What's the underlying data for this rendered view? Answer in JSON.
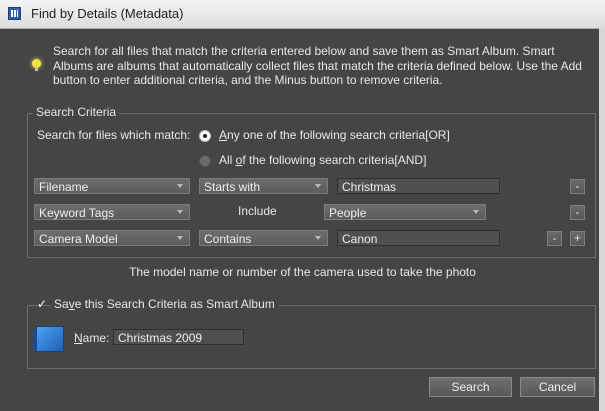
{
  "window": {
    "title": "Find by Details (Metadata)"
  },
  "info": {
    "text": "Search for all files that match the criteria entered below and save them as Smart Album. Smart Albums are albums that automatically collect files that match the criteria defined below. Use the Add button to enter additional criteria, and the Minus button to remove criteria."
  },
  "search_criteria": {
    "legend": "Search Criteria",
    "match_label": "Search for files which match:",
    "options": [
      {
        "pre": "",
        "u": "A",
        "post": "ny one of the following search criteria[OR]",
        "selected": true
      },
      {
        "pre": "All ",
        "u": "o",
        "post": "f the following search criteria[AND]",
        "selected": false
      }
    ],
    "rows": [
      {
        "field": "Filename",
        "operator": "Starts with",
        "value": "Christmas"
      },
      {
        "field": "Keyword Tags",
        "operator": "Include",
        "value": "People"
      },
      {
        "field": "Camera Model",
        "operator": "Contains",
        "value": "Canon"
      }
    ],
    "minus_label": "-",
    "plus_label": "+"
  },
  "hint": "The model name or number of the camera used to take the photo",
  "save": {
    "checked": true,
    "check_glyph": "✓",
    "legend_pre": "Sa",
    "legend_u": "v",
    "legend_post": "e this Search Criteria as Smart Album",
    "name_label_u": "N",
    "name_label_post": "ame:",
    "name_value": "Christmas 2009"
  },
  "buttons": {
    "search": "Search",
    "cancel": "Cancel"
  },
  "colors": {
    "background": "#454545",
    "titlebar": "#e8e8e8",
    "album_icon": "#2f7fd8"
  }
}
